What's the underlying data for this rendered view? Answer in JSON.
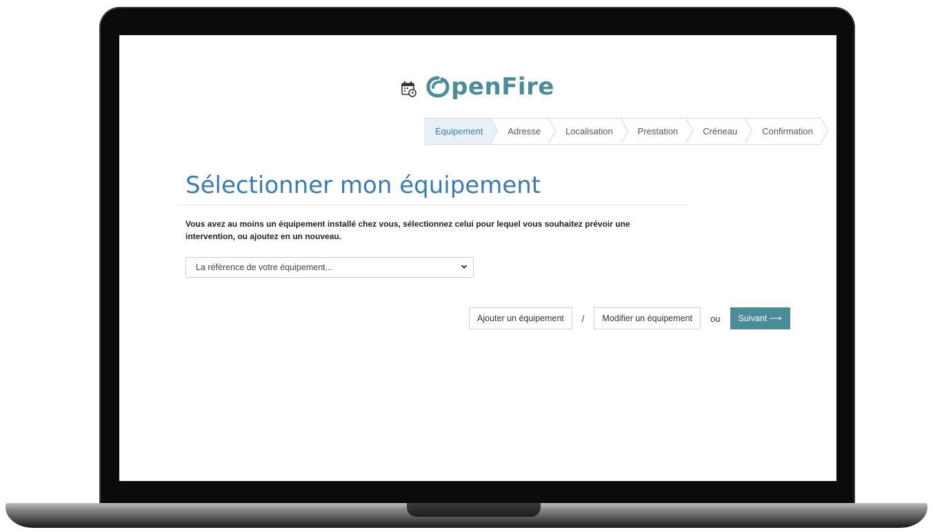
{
  "brand": {
    "logo_text": "penFire",
    "logo_letter": "O"
  },
  "steps": [
    {
      "label": "Équipement",
      "active": true
    },
    {
      "label": "Adresse",
      "active": false
    },
    {
      "label": "Localisation",
      "active": false
    },
    {
      "label": "Prestation",
      "active": false
    },
    {
      "label": "Créneau",
      "active": false
    },
    {
      "label": "Confirmation",
      "active": false
    }
  ],
  "page": {
    "title": "Sélectionner mon équipement",
    "instructions": "Vous avez au moins un équipement installé chez vous, sélectionnez celui pour lequel vous souhaitez prévoir une intervention, ou ajoutez en un nouveau.",
    "select_value": "La référence de votre équipement..."
  },
  "actions": {
    "add_label": "Ajouter un équipement",
    "slash": "/",
    "edit_label": "Modifier un équipement",
    "or": "ou",
    "next_label": "Suivant ⟶"
  },
  "colors": {
    "brand": "#4a8d99",
    "title": "#3a7ab5",
    "active_step_bg": "#e8f1f8"
  }
}
